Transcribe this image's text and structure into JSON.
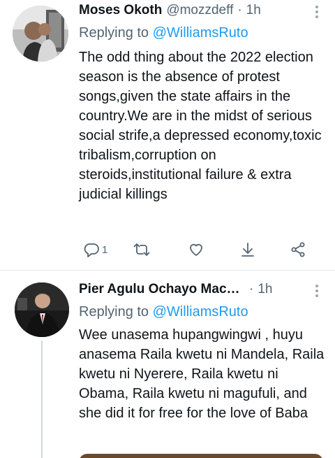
{
  "tweets": [
    {
      "author": {
        "name": "Moses Okoth",
        "handle": "@mozzdeff"
      },
      "separator": "·",
      "time": "1h",
      "replying_prefix": "Replying to",
      "replying_to": "@WilliamsRuto",
      "text": "The odd thing about the 2022 election season is the absence of protest songs,given the state affairs in the country.We are in the midst of serious social strife,a depressed economy,toxic tribalism,corruption on steroids,institutional failure & extra judicial killings",
      "actions": {
        "reply": {
          "icon": "reply-icon",
          "count": "1"
        },
        "retweet": {
          "icon": "retweet-icon"
        },
        "like": {
          "icon": "heart-icon"
        },
        "download": {
          "icon": "download-icon"
        },
        "share": {
          "icon": "share-icon"
        }
      }
    },
    {
      "author": {
        "name": "Pier Agulu Ochayo Mach ..."
      },
      "separator": "·",
      "time": "1h",
      "replying_prefix": "Replying to",
      "replying_to": "@WilliamsRuto",
      "text": "Wee unasema hupangwingwi , huyu anasema Raila kwetu ni Mandela, Raila kwetu ni Nyerere, Raila kwetu ni Obama, Raila kwetu ni magufuli, and she did it for free for the love of Baba"
    }
  ],
  "colors": {
    "link": "#1d9bf0",
    "secondary": "#536471",
    "text": "#0f1419"
  }
}
